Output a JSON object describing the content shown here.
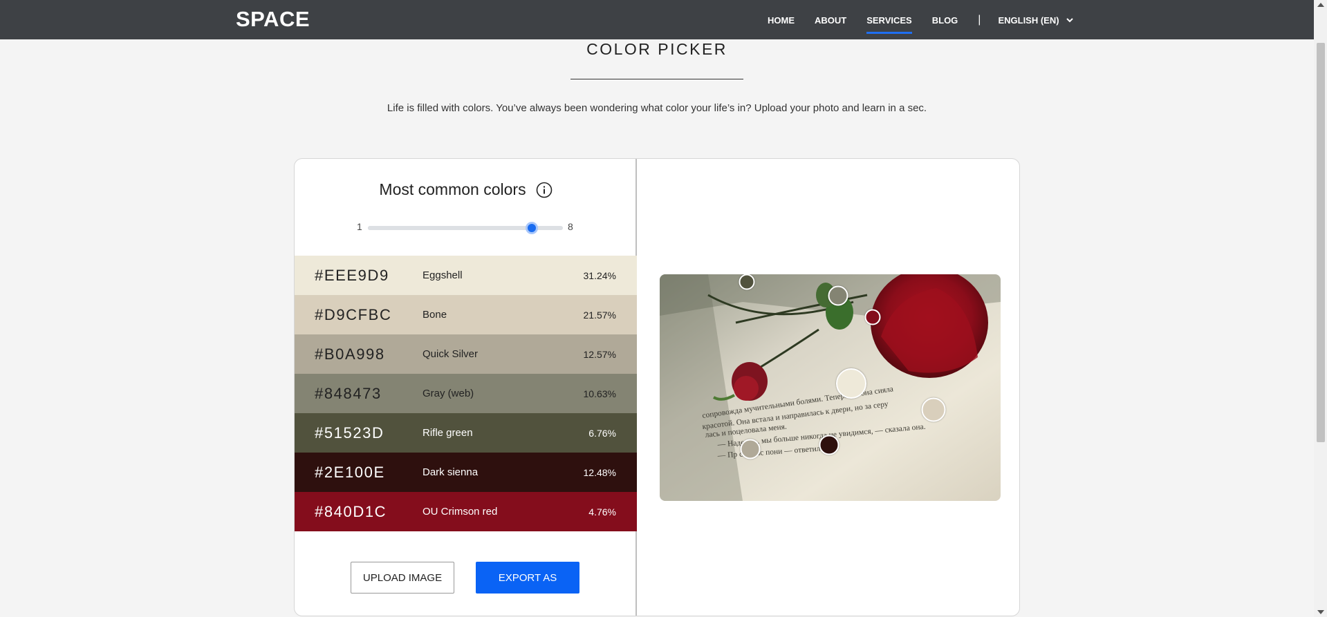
{
  "header": {
    "logo": "SPACE",
    "nav": [
      "HOME",
      "ABOUT",
      "SERVICES",
      "BLOG"
    ],
    "active_nav": "SERVICES",
    "separator": "|",
    "language": "ENGLISH (EN)"
  },
  "page": {
    "title": "COLOR PICKER",
    "subtitle": "Life is filled with colors. You’ve always been wondering what color your life’s in? Upload your photo and learn in a sec."
  },
  "panel": {
    "heading": "Most common colors",
    "slider": {
      "min_label": "1",
      "max_label": "8",
      "value_fraction": 0.84
    },
    "colors": [
      {
        "hex": "#EEE9D9",
        "name": "Eggshell",
        "percent": "31.24%",
        "bg": "#EEE9D9",
        "text": "#222222"
      },
      {
        "hex": "#D9CFBC",
        "name": "Bone",
        "percent": "21.57%",
        "bg": "#D9CFBC",
        "text": "#222222"
      },
      {
        "hex": "#B0A998",
        "name": "Quick Silver",
        "percent": "12.57%",
        "bg": "#B0A998",
        "text": "#222222"
      },
      {
        "hex": "#848473",
        "name": "Gray (web)",
        "percent": "10.63%",
        "bg": "#848473",
        "text": "#222222"
      },
      {
        "hex": "#51523D",
        "name": "Rifle green",
        "percent": "6.76%",
        "bg": "#51523D",
        "text": "#ffffff"
      },
      {
        "hex": "#2E100E",
        "name": "Dark sienna",
        "percent": "12.48%",
        "bg": "#2E100E",
        "text": "#ffffff"
      },
      {
        "hex": "#840D1C",
        "name": "OU Crimson red",
        "percent": "4.76%",
        "bg": "#840D1C",
        "text": "#ffffff"
      }
    ],
    "upload_label": "UPLOAD IMAGE",
    "export_label": "EXPORT AS"
  },
  "image": {
    "lines": [
      "— Надеюсь, мы больше никогда не увидимся, — сказала она.",
      "— Пр       сно вас пони      — ответил я.",
      "лась и поцеловала меня.",
      "красотой. Она встала и направилась к двери, но за   серу",
      "сопровожда мучительными болями. Теперь же она сияла"
    ],
    "markers": [
      {
        "color": "#51523D"
      },
      {
        "color": "#848473"
      },
      {
        "color": "#840D1C"
      },
      {
        "color": "#EEE9D9"
      },
      {
        "color": "#D9CFBC"
      },
      {
        "color": "#B0A998"
      },
      {
        "color": "#2E100E"
      }
    ]
  },
  "colors": {
    "header_bg": "#3e4145",
    "accent": "#1a6cf0",
    "export_btn": "#0a63f5"
  }
}
